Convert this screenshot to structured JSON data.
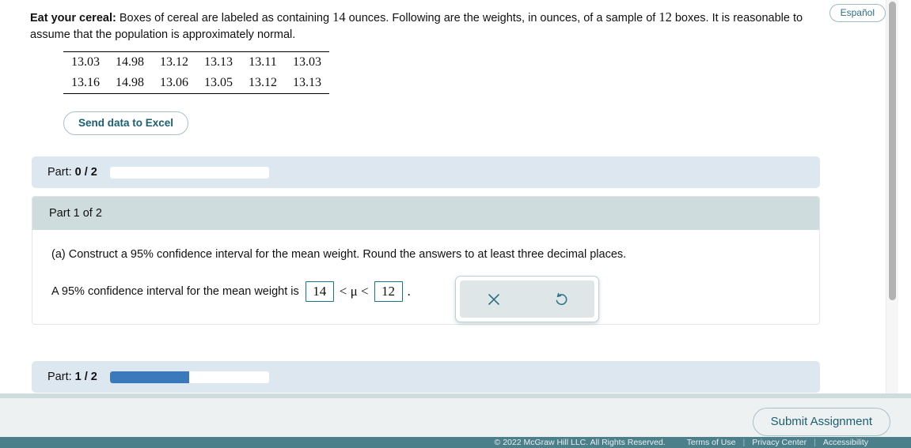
{
  "header": {
    "espanol_label": "Español"
  },
  "problem": {
    "title": "Eat your cereal:",
    "text_part1": " Boxes of cereal are labeled as containing ",
    "labeled_ounces": "14",
    "text_part2": " ounces. Following are the weights, in ounces, of a sample of ",
    "sample_size": "12",
    "text_part3": " boxes. It is reasonable to assume that the population is approximately normal."
  },
  "data_table": {
    "rows": [
      [
        "13.03",
        "14.98",
        "13.12",
        "13.13",
        "13.11",
        "13.03"
      ],
      [
        "13.16",
        "14.98",
        "13.06",
        "13.05",
        "13.12",
        "13.13"
      ]
    ]
  },
  "excel_button": {
    "label": "Send data to Excel"
  },
  "progress": [
    {
      "label_prefix": "Part: ",
      "label_value": "0 / 2",
      "percent": 0
    },
    {
      "label_prefix": "Part: ",
      "label_value": "1 / 2",
      "percent": 50
    }
  ],
  "question_card": {
    "header": "Part 1 of 2",
    "prompt": "(a) Construct a 95% confidence interval for the mean weight. Round the answers to at least three decimal places.",
    "answer_lead": "A 95% confidence interval for the mean weight is",
    "lower_value": "14",
    "inequality_left": "<",
    "mu": "μ",
    "inequality_right": "<",
    "upper_value": "12",
    "trailing_period": "."
  },
  "tool_palette": {
    "clear_icon": "x-close-icon",
    "undo_icon": "undo-circular-arrow-icon"
  },
  "footer": {
    "submit_label": "Submit Assignment",
    "copyright": "© 2022 McGraw Hill LLC. All Rights Reserved.",
    "links": [
      "Terms of Use",
      "Privacy Center",
      "Accessibility"
    ],
    "separator": "|"
  },
  "colors": {
    "accent_teal": "#1b5f70",
    "input_border": "#18768a",
    "progress_fill": "#3b79bd",
    "progress_bg": "#dde7f0",
    "card_header": "#cfdcdd",
    "legal_bar": "#4b7f8a"
  }
}
